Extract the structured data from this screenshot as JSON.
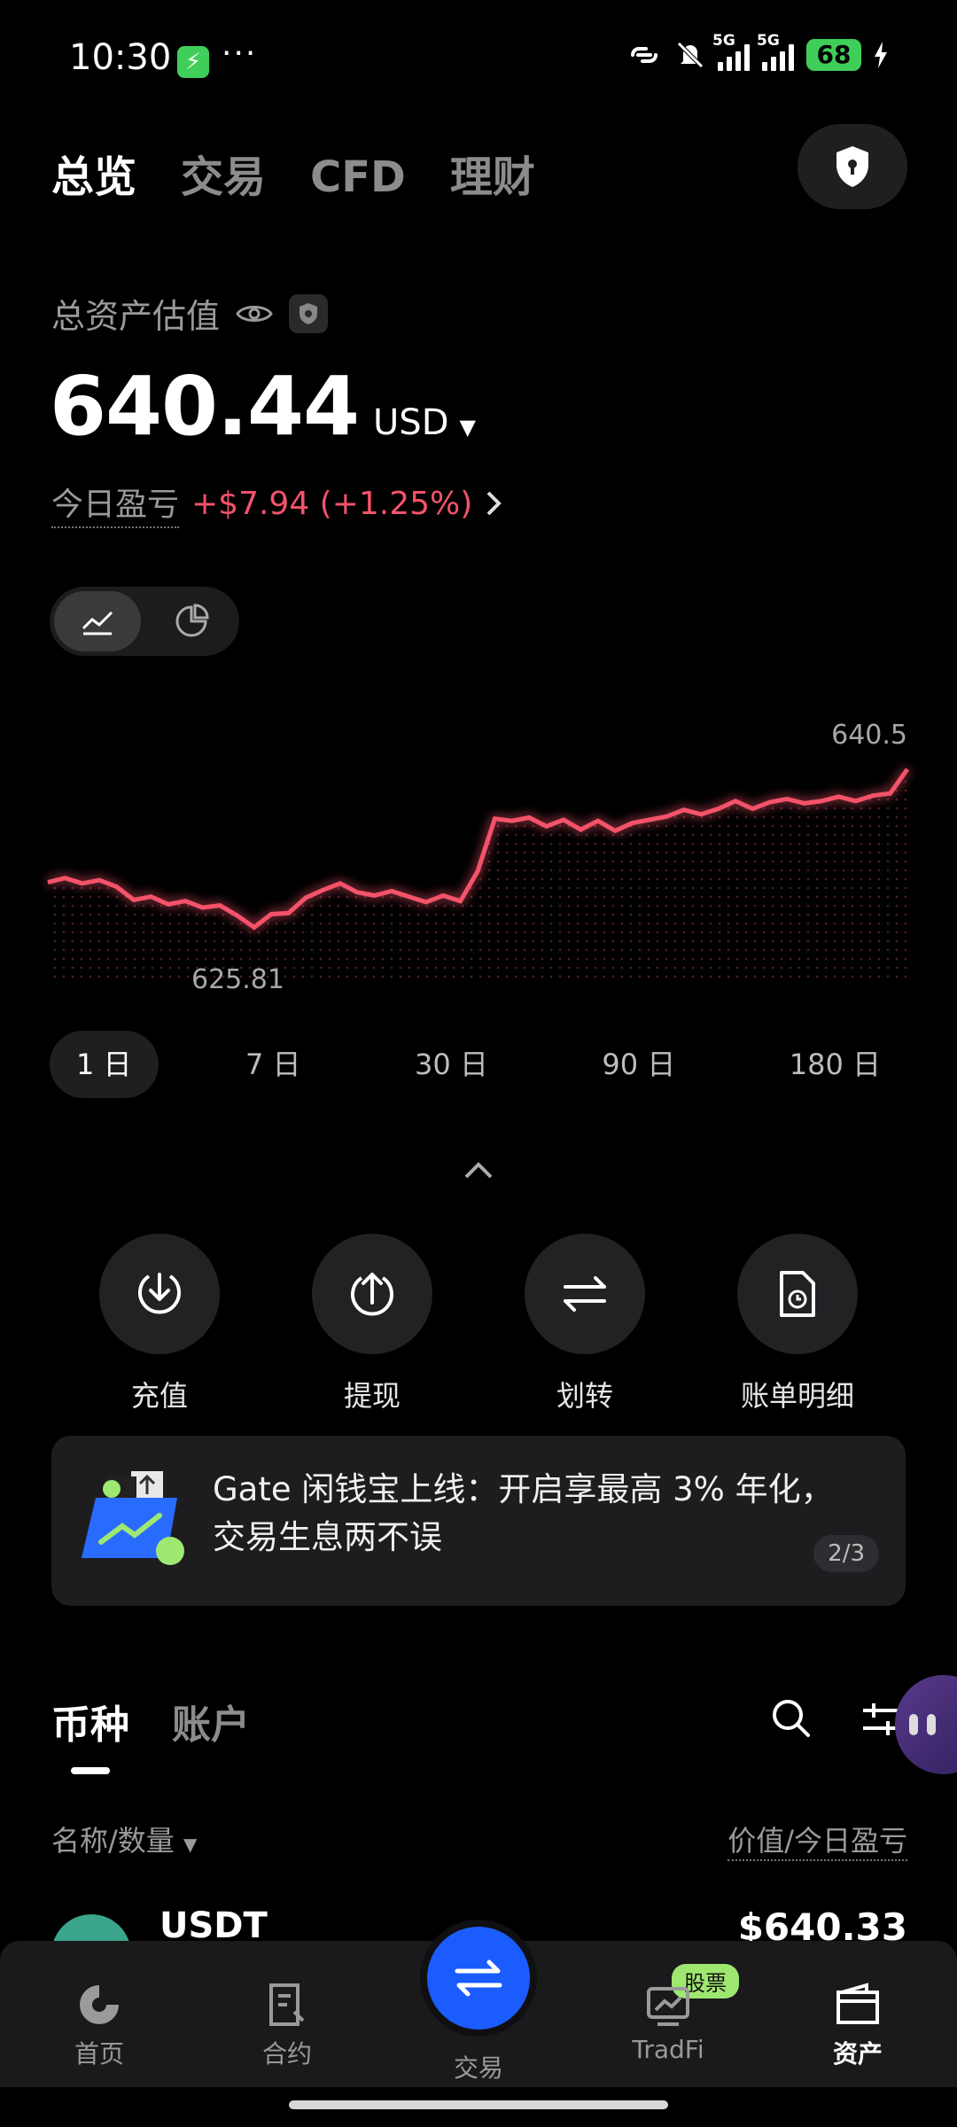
{
  "status": {
    "time": "10:30",
    "battery": "68",
    "network1": "5G",
    "network2": "5G"
  },
  "top_tabs": [
    "总览",
    "交易",
    "CFD",
    "理财"
  ],
  "assets": {
    "label": "总资产估值",
    "value": "640.44",
    "currency": "USD",
    "pnl_label": "今日盈亏",
    "pnl_value": "+$7.94 (+1.25%)"
  },
  "chart": {
    "max_label": "640.5",
    "min_label": "625.81",
    "line_color": "#f4536b"
  },
  "chart_data": {
    "type": "line",
    "ylim": [
      625.81,
      640.5
    ],
    "values": [
      630.2,
      630.6,
      630.1,
      630.4,
      629.8,
      628.6,
      628.9,
      628.2,
      628.5,
      627.9,
      628.1,
      627.2,
      626.1,
      627.3,
      627.4,
      628.8,
      629.5,
      630.1,
      629.3,
      629.0,
      629.4,
      628.9,
      628.4,
      629.0,
      628.5,
      631.2,
      636.0,
      635.8,
      636.1,
      635.3,
      635.9,
      635.0,
      635.8,
      634.9,
      635.6,
      635.9,
      636.2,
      636.8,
      636.4,
      636.9,
      637.6,
      636.9,
      637.5,
      637.8,
      637.4,
      637.6,
      638.0,
      637.6,
      638.1,
      638.3,
      640.5
    ]
  },
  "ranges": [
    "1 日",
    "7 日",
    "30 日",
    "90 日",
    "180 日"
  ],
  "actions": [
    {
      "label": "充值",
      "icon": "deposit-icon"
    },
    {
      "label": "提现",
      "icon": "withdraw-icon"
    },
    {
      "label": "划转",
      "icon": "transfer-icon"
    },
    {
      "label": "账单明细",
      "icon": "bill-icon"
    }
  ],
  "banner": {
    "line1": "Gate 闲钱宝上线：开启享最高 3% 年化，",
    "line2": "交易生息两不误",
    "page": "2/3"
  },
  "coin_tabs": [
    "币种",
    "账户"
  ],
  "list_head": {
    "left": "名称/数量",
    "right": "价值/今日盈亏"
  },
  "row": {
    "name": "USDT",
    "value": "$640.33"
  },
  "nav": {
    "home": "首页",
    "futures": "合约",
    "trade": "交易",
    "tradfi": "TradFi",
    "stock_badge": "股票",
    "assets": "资产"
  }
}
